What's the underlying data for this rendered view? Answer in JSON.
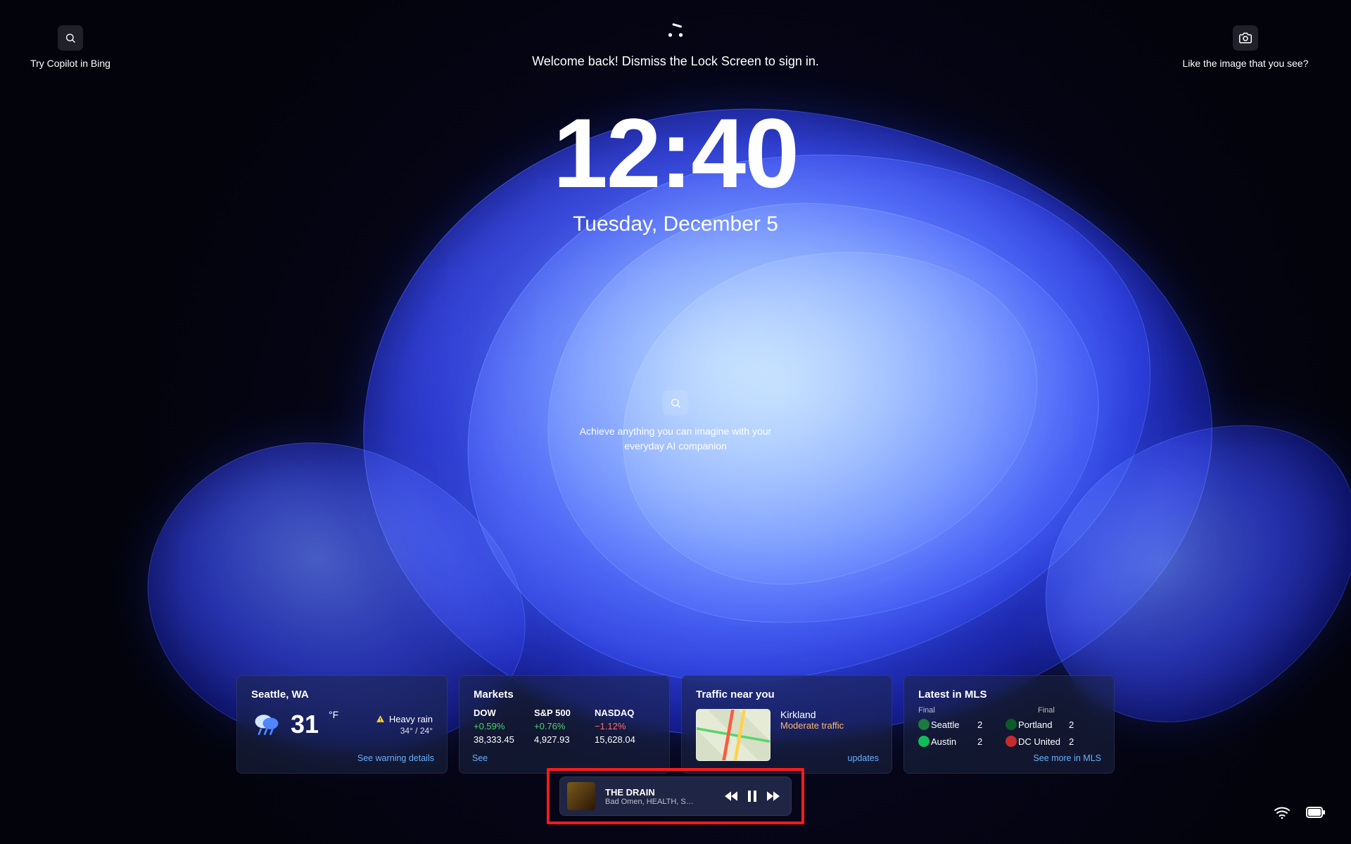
{
  "top": {
    "copilot_label": "Try Copilot in Bing",
    "welcome": "Welcome back! Dismiss the Lock Screen to sign in.",
    "like_label": "Like the image that you see?"
  },
  "clock": {
    "time": "12:40",
    "date": "Tuesday, December 5"
  },
  "center_search": {
    "line1": "Achieve anything you can imagine with your",
    "line2": "everyday AI companion"
  },
  "weather": {
    "title": "Seattle, WA",
    "temp": "31",
    "unit": "°F",
    "condition": "Heavy rain",
    "hi_lo": "34° / 24°",
    "link": "See warning details"
  },
  "markets": {
    "title": "Markets",
    "cols": [
      "DOW",
      "S&P 500",
      "NASDAQ"
    ],
    "pct": [
      "+0.59%",
      "+0.76%",
      "−1.12%"
    ],
    "pct_sign": [
      "pos",
      "pos",
      "neg"
    ],
    "val": [
      "38,333.45",
      "4,927.93",
      "15,628.04"
    ],
    "link": "See"
  },
  "traffic": {
    "title": "Traffic near you",
    "loc": "Kirkland",
    "status": "Moderate traffic",
    "link": "updates"
  },
  "mls": {
    "title": "Latest in MLS",
    "final": "Final",
    "rows": [
      {
        "h": "Seattle",
        "hs": "2",
        "a": "Portland",
        "as": "2",
        "hc": "#1b7a3d",
        "ac": "#0c5a2a"
      },
      {
        "h": "Austin",
        "hs": "2",
        "a": "DC United",
        "as": "2",
        "hc": "#0fbf55",
        "ac": "#c62b2b"
      }
    ],
    "link": "See more in MLS"
  },
  "media": {
    "title": "THE DRAIN",
    "subtitle": "Bad Omen, HEALTH, S…"
  }
}
